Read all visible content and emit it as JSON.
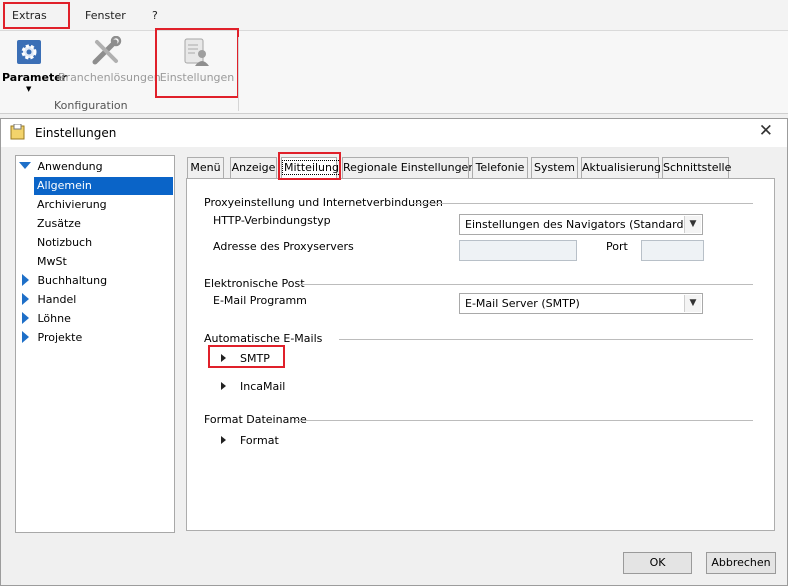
{
  "menu": {
    "extras": "Extras",
    "fenster": "Fenster",
    "help": "?"
  },
  "ribbon": {
    "parameter": "Parameter",
    "branchen": "Branchenlösungen",
    "einstellungen": "Einstellungen",
    "group": "Konfiguration"
  },
  "dialog": {
    "title": "Einstellungen",
    "close": "✕",
    "tree": {
      "anwendung": "Anwendung",
      "allgemein": "Allgemein",
      "archivierung": "Archivierung",
      "zusaetze": "Zusätze",
      "notizbuch": "Notizbuch",
      "mwst": "MwSt",
      "buchhaltung": "Buchhaltung",
      "handel": "Handel",
      "loehne": "Löhne",
      "projekte": "Projekte"
    },
    "tabs": {
      "menu": "Menü",
      "anzeige": "Anzeige",
      "mitteilung": "Mitteilung",
      "regional": "Regionale Einstellungen",
      "telefonie": "Telefonie",
      "system": "System",
      "aktualisierung": "Aktualisierung",
      "schnittstelle": "Schnittstelle"
    },
    "proxy": {
      "section": "Proxyeinstellung und Internetverbindungen",
      "http_label": "HTTP-Verbindungstyp",
      "http_value": "Einstellungen des Navigators (Standard)",
      "address_label": "Adresse des Proxyservers",
      "port_label": "Port"
    },
    "email": {
      "section": "Elektronische Post",
      "program_label": "E-Mail Programm",
      "program_value": "E-Mail Server (SMTP)"
    },
    "auto": {
      "section": "Automatische E-Mails",
      "smtp": "SMTP",
      "incamail": "IncaMail"
    },
    "format": {
      "section": "Format Dateiname",
      "format": "Format"
    },
    "buttons": {
      "ok": "OK",
      "cancel": "Abbrechen"
    }
  }
}
